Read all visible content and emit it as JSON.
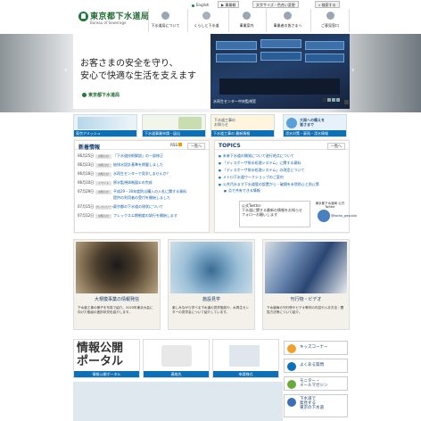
{
  "header": {
    "logo_title": "東京都下水道局",
    "logo_sub": "Bureau of Sewerage",
    "util_english": "English",
    "util_sitemap": "▶ 事業概",
    "util_fontsize": "文字サイズ・色合い変更",
    "util_search": "検索する",
    "nav": [
      {
        "label": "下水道局について"
      },
      {
        "label": "くらしと下水道"
      },
      {
        "label": "事業案内"
      },
      {
        "label": "事業者の皆さまへ"
      },
      {
        "label": "ご意見窓口"
      }
    ]
  },
  "hero": {
    "copy_line1": "お客さまの安全を守り、",
    "copy_line2": "安心で快適な生活を支えます",
    "logo_text": "東京都下水道局",
    "photo_caption": "水再生センター中央監視室",
    "pager": [
      "1",
      "2",
      "3",
      "4"
    ]
  },
  "banners": [
    {
      "title": "",
      "bar": "東京アメッシュ"
    },
    {
      "title": "",
      "bar": "下水道事業申請・届出"
    },
    {
      "title": "下水道工事の\nお知らせ",
      "bar": "下水道工事の\n最新情報"
    },
    {
      "title": "大雨への備えを\n皆さまで",
      "bar": "浸水対策・豪雨・浸水情報"
    }
  ],
  "news": {
    "heading": "新着情報",
    "rss": "RSS",
    "more": "一覧へ",
    "items": [
      {
        "date": "06月25日",
        "tag": "お知らせ",
        "text": "「下水道技術解説」の一部修正"
      },
      {
        "date": "06月23日",
        "tag": "お知らせ",
        "text": "給排水設計基準を掲載しました"
      },
      {
        "date": "06月16日",
        "tag": "お知らせ",
        "text": "水再生センターで見学しませんか？"
      },
      {
        "date": "06月10日",
        "tag": "イベント",
        "text": "原水監視体制図①の完成"
      },
      {
        "date": "07月29日",
        "tag": "お知らせ",
        "text": "平成29・30年度防災購入の入札に関する資料"
      },
      {
        "date": "",
        "tag": "",
        "text": "提供の利用者の受付を開始しました"
      },
      {
        "date": "07月15日",
        "tag": "プレスリリース",
        "text": "東京都の下水道の現状について"
      },
      {
        "date": "07月12日",
        "tag": "お知らせ",
        "text": "フレックスエ期制度の試行を開始します"
      }
    ]
  },
  "topics": {
    "heading": "TOPICS",
    "more": "一覧へ",
    "items": [
      "未来下水道の開発について遂行地点について",
      "「ディスポーザ排水処理システム」に関する資料",
      "「ディスポーザ排水処理システム」の改定について",
      "メトロ下水道ワークショップのご案内",
      "公共汚水ます下水道管の設置から・破損を未然防止と防止策",
      "点で共有できる情報"
    ],
    "twitter_line1": "公式Twitter",
    "twitter_line2": "下水道に関する最新の情報をお知らせ",
    "twitter_line3": "フォローお願いします",
    "twitter_account": "@tocho_gesuido",
    "mascot_caption": "東京都下水道局 公式Twitter"
  },
  "cards": [
    {
      "title": "大規模事業の情報発信",
      "desc": "下水道工事の様子を写真で紹介。2020年東京大会に向けた取組の進捗状況を紹介します。"
    },
    {
      "title": "施設見学",
      "desc": "楽しみながら学べる下水道の見学施設や、水再生センターの見学会について紹介しています。"
    },
    {
      "title": "刊行物・ビデオ",
      "desc": "下水道局の刊行物やビデオ教材の内容や入手方法・閲覧方法等について紹介。"
    }
  ],
  "bottom": [
    {
      "big1": "情報公開",
      "big2": "ポータル",
      "bar": "情報公開ポータル"
    },
    {
      "bar": "連絡先"
    },
    {
      "bar": "申請様式"
    },
    {
      "bar": "よくある質問"
    }
  ],
  "side": [
    {
      "label": "キッズコーナー"
    },
    {
      "label": "よくある質問"
    },
    {
      "label": "モニター・\nメールマガジン"
    },
    {
      "label": "下水道で\n発見する\n東京の下水道"
    }
  ],
  "colors": {
    "brand_green": "#1c7a3b",
    "accent_blue": "#0d70b7"
  }
}
